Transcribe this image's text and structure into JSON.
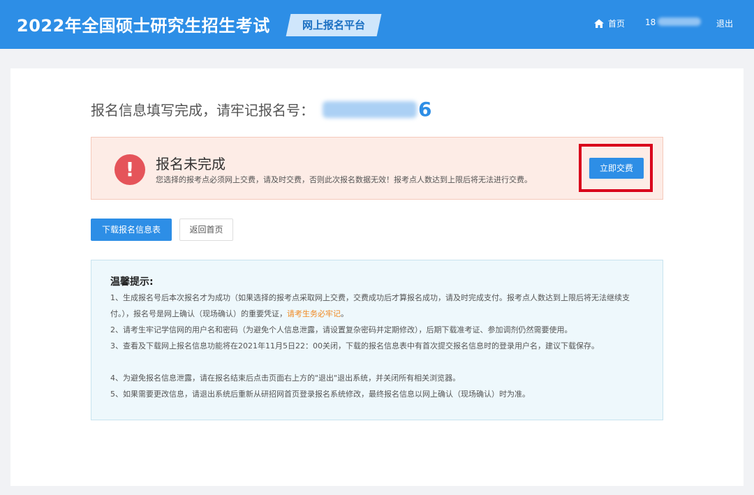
{
  "header": {
    "title": "2022年全国硕士研究生招生考试",
    "platform": "网上报名平台",
    "home_label": "首页",
    "user_prefix": "18",
    "logout_label": "退出"
  },
  "registration": {
    "prompt": "报名信息填写完成，请牢记报名号：",
    "number_last_digit": "6"
  },
  "alert": {
    "title": "报名未完成",
    "message": "您选择的报考点必须网上交费，请及时交费，否则此次报名数据无效！报考点人数达到上限后将无法进行交费。",
    "icon": "!",
    "pay_button": "立即交费"
  },
  "actions": {
    "download": "下载报名信息表",
    "back_home": "返回首页"
  },
  "tips": {
    "title": "温馨提示:",
    "items": [
      {
        "before": "1、生成报名号后本次报名才为成功（如果选择的报考点采取网上交费，交费成功后才算报名成功，请及时完成支付。报考点人数达到上限后将无法继续支付。），报名号是网上确认（现场确认）的重要凭证，",
        "highlight": "请考生务必牢记",
        "after": "。"
      },
      {
        "text": "2、请考生牢记学信网的用户名和密码（为避免个人信息泄露，请设置复杂密码并定期修改），后期下载准考证、参加调剂仍然需要使用。"
      },
      {
        "text": "3、查看及下载网上报名信息功能将在2021年11月5日22：00关闭，下载的报名信息表中有首次提交报名信息时的登录用户名，建议下载保存。"
      },
      {
        "text": "4、为避免报名信息泄露，请在报名结束后点击页面右上方的\"退出\"退出系统，并关闭所有相关浏览器。"
      },
      {
        "text": "5、如果需要更改信息，请退出系统后重新从研招网首页登录报名系统修改，最终报名信息以网上确认（现场确认）时为准。"
      }
    ]
  },
  "colors": {
    "primary": "#2d8ee6",
    "alert_bg": "#fdece6",
    "alert_icon": "#e5545a",
    "highlight": "#f08a24",
    "annotation_frame": "#d9001b"
  }
}
